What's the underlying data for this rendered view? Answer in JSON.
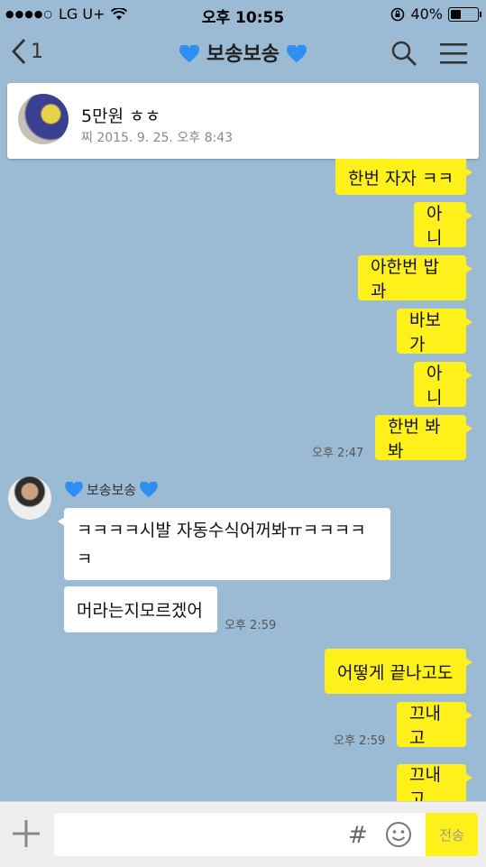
{
  "statusbar": {
    "carrier": "LG U+",
    "time": "오후 10:55",
    "battery": "40%"
  },
  "nav": {
    "back_count": "1",
    "title": "보송보송"
  },
  "notice": {
    "headline": "5만원 ㅎㅎ",
    "date": "찌 2015. 9. 25. 오후 8:43"
  },
  "chat": {
    "mine_1": [
      "한번 자자 ㅋㅋ",
      "아니",
      "아한번 밥과",
      "바보가",
      "아니",
      "한번 봐봐"
    ],
    "mine_1_time": "오후 2:47",
    "friend": {
      "name": "보송보송",
      "msg1": "ㅋㅋㅋㅋ시발 자동수식어꺼봐ㅠㅋㅋㅋㅋㅋ",
      "msg2": "머라는지모르겠어",
      "time": "오후 2:59"
    },
    "mine_2": [
      "어떻게 끝나고도",
      "끄내고"
    ],
    "mine_2_time": "오후 2:59",
    "mine_3": "끄내고"
  },
  "input": {
    "hash": "#",
    "send": "전송"
  },
  "colors": {
    "background": "#9bbbd4",
    "my_bubble": "#fef01b",
    "friend_bubble": "#ffffff"
  }
}
